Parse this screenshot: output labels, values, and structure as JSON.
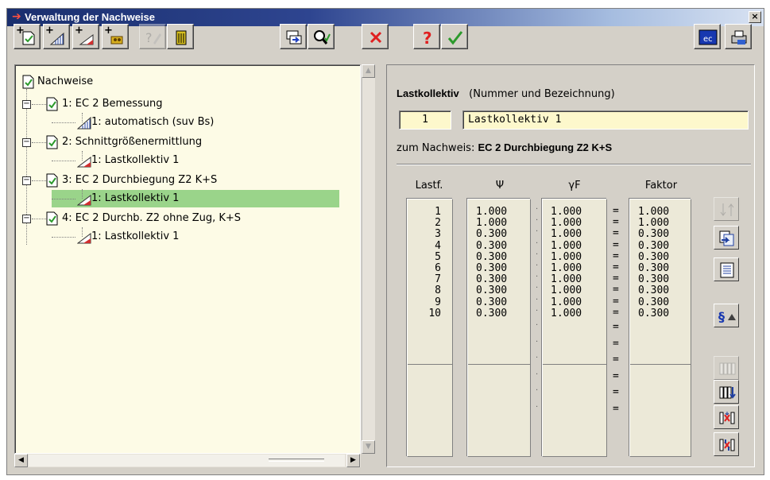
{
  "window": {
    "title": "Verwaltung der Nachweise",
    "close_glyph": "×"
  },
  "toolbar": {
    "buttons": [
      {
        "name": "new-nachweis-icon",
        "enabled": true
      },
      {
        "name": "new-lastkollektiv-bemessung-icon",
        "enabled": true
      },
      {
        "name": "new-lastkollektiv-icon",
        "enabled": true
      },
      {
        "name": "new-material-icon",
        "enabled": true
      },
      {
        "name": "edit-icon",
        "enabled": false
      },
      {
        "name": "trash-icon",
        "enabled": true
      },
      {
        "name": "copy-arrow-icon",
        "enabled": true
      },
      {
        "name": "search-check-icon",
        "enabled": true
      },
      {
        "name": "cancel-x-icon",
        "enabled": true
      },
      {
        "name": "help-icon",
        "enabled": true
      },
      {
        "name": "ok-check-icon",
        "enabled": true
      },
      {
        "name": "eurocode-icon",
        "enabled": true
      },
      {
        "name": "print-icon",
        "enabled": true
      }
    ],
    "ec_label": "ec"
  },
  "tree": {
    "root": "Nachweise",
    "items": [
      {
        "label": "1: EC 2 Bemessung",
        "children": [
          "1: automatisch (suv Bs)"
        ]
      },
      {
        "label": "2: Schnittgrößenermittlung",
        "children": [
          "1: Lastkollektiv 1"
        ]
      },
      {
        "label": "3: EC 2 Durchbiegung Z2 K+S",
        "children": [
          "1: Lastkollektiv 1"
        ]
      },
      {
        "label": "4: EC 2 Durchb. Z2 ohne Zug, K+S",
        "children": [
          "1: Lastkollektiv 1"
        ]
      }
    ],
    "expander_glyph": "−",
    "selected": "3.1"
  },
  "detail": {
    "heading_bold": "Lastkollektiv",
    "heading_rest": "(Nummer und Bezeichnung)",
    "number": "1",
    "name": "Lastkollektiv 1",
    "nachweis_prefix": "zum Nachweis:",
    "nachweis_name": "EC 2 Durchbiegung Z2 K+S",
    "columns": {
      "lastf": "Lastf.",
      "psi": "Ψ",
      "gamma": "γF",
      "faktor": "Faktor"
    },
    "rows": [
      {
        "lastf": "1",
        "psi": "1.000",
        "gamma": "1.000",
        "faktor": "1.000"
      },
      {
        "lastf": "2",
        "psi": "1.000",
        "gamma": "1.000",
        "faktor": "1.000"
      },
      {
        "lastf": "3",
        "psi": "0.300",
        "gamma": "1.000",
        "faktor": "0.300"
      },
      {
        "lastf": "4",
        "psi": "0.300",
        "gamma": "1.000",
        "faktor": "0.300"
      },
      {
        "lastf": "5",
        "psi": "0.300",
        "gamma": "1.000",
        "faktor": "0.300"
      },
      {
        "lastf": "6",
        "psi": "0.300",
        "gamma": "1.000",
        "faktor": "0.300"
      },
      {
        "lastf": "7",
        "psi": "0.300",
        "gamma": "1.000",
        "faktor": "0.300"
      },
      {
        "lastf": "8",
        "psi": "0.300",
        "gamma": "1.000",
        "faktor": "0.300"
      },
      {
        "lastf": "9",
        "psi": "0.300",
        "gamma": "1.000",
        "faktor": "0.300"
      },
      {
        "lastf": "10",
        "psi": "0.300",
        "gamma": "1.000",
        "faktor": "0.300"
      }
    ],
    "eq_glyph": "=",
    "dot_glyph": "·"
  },
  "side_buttons": [
    {
      "name": "move-down-up-icon",
      "enabled": false
    },
    {
      "name": "import-icon",
      "enabled": true
    },
    {
      "name": "table-icon",
      "enabled": true
    },
    {
      "name": "paragraph-icon",
      "enabled": true
    },
    {
      "name": "columns-icon",
      "enabled": false
    },
    {
      "name": "columns-sort-icon",
      "enabled": true
    },
    {
      "name": "columns-delete-icon",
      "enabled": true
    },
    {
      "name": "columns-swap-icon",
      "enabled": true
    }
  ]
}
